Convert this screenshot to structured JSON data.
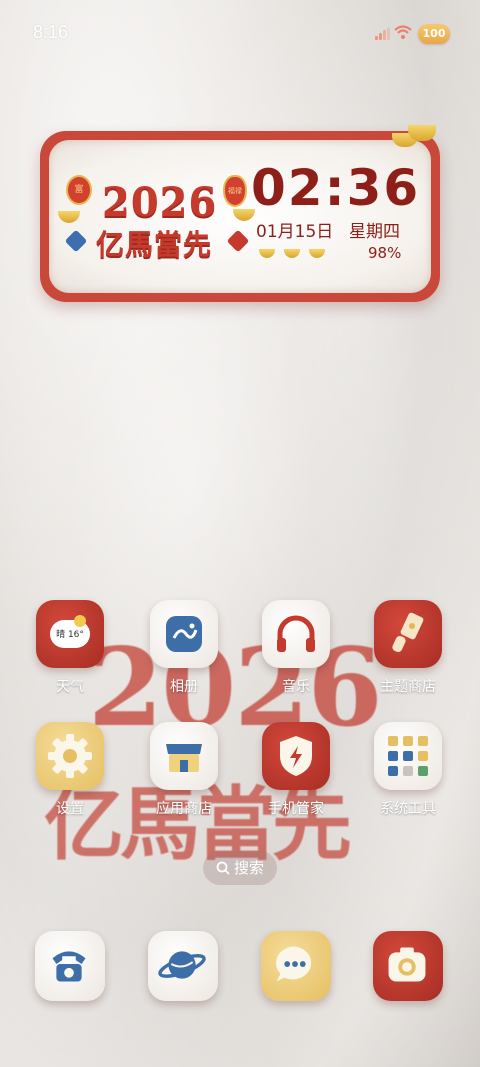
{
  "status_bar": {
    "time": "8:16",
    "battery_level": "100",
    "icons": [
      "signal-icon",
      "wifi-icon",
      "battery-icon"
    ]
  },
  "widget": {
    "year": "2026",
    "motto": "亿馬當先",
    "clock": "02:36",
    "date": "01月15日",
    "weekday": "星期四",
    "battery": "98%",
    "decor_text": {
      "lantern": "富",
      "gourd": "福禄"
    }
  },
  "apps": [
    {
      "label": "天气",
      "icon": "weather-icon",
      "badge": "晴 16°"
    },
    {
      "label": "相册",
      "icon": "gallery-icon"
    },
    {
      "label": "音乐",
      "icon": "headphones-icon"
    },
    {
      "label": "主题商店",
      "icon": "theme-store-icon"
    },
    {
      "label": "设置",
      "icon": "gear-icon"
    },
    {
      "label": "应用商店",
      "icon": "app-store-icon"
    },
    {
      "label": "手机管家",
      "icon": "phone-manager-icon"
    },
    {
      "label": "系统工具",
      "icon": "system-tools-folder-icon"
    }
  ],
  "wallpaper": {
    "year": "2026",
    "motto": "亿馬當先"
  },
  "search": {
    "label": "搜索"
  },
  "dock": [
    {
      "icon": "phone-icon"
    },
    {
      "icon": "browser-planet-icon"
    },
    {
      "icon": "messages-icon"
    },
    {
      "icon": "camera-icon"
    }
  ],
  "colors": {
    "accent_red": "#c53a2c",
    "dark_red": "#8e1f18",
    "fur_white": "#ece6df",
    "gold": "#e6b84c",
    "blue": "#3d6ea8"
  }
}
